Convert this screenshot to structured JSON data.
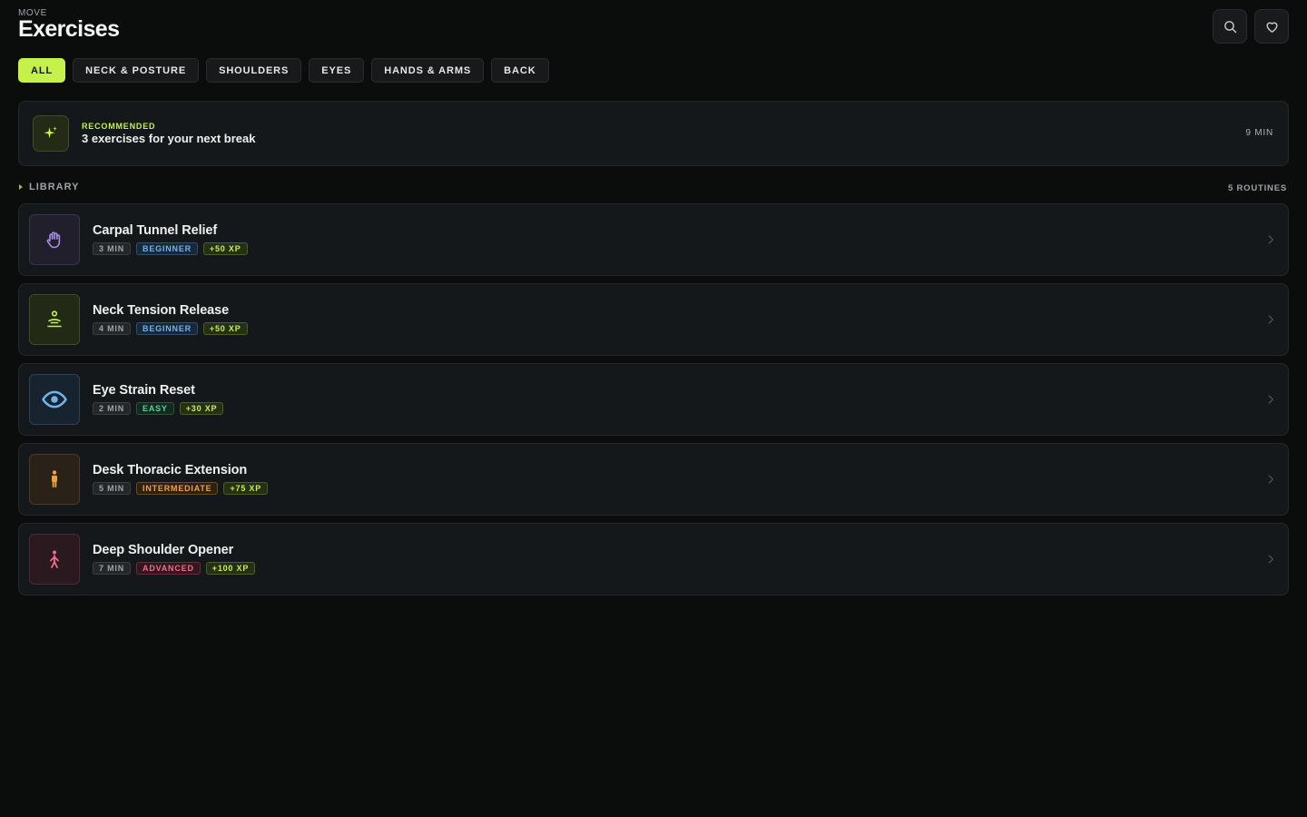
{
  "header": {
    "eyebrow": "MOVE",
    "title": "Exercises",
    "actions": [
      {
        "icon": "search-icon"
      },
      {
        "icon": "heart-icon"
      }
    ]
  },
  "filters": [
    {
      "label": "ALL",
      "active": true
    },
    {
      "label": "NECK & POSTURE",
      "active": false
    },
    {
      "label": "SHOULDERS",
      "active": false
    },
    {
      "label": "EYES",
      "active": false
    },
    {
      "label": "HANDS & ARMS",
      "active": false
    },
    {
      "label": "BACK",
      "active": false
    }
  ],
  "recommended": {
    "icon": "sparkle-icon",
    "eyebrow": "RECOMMENDED",
    "title": "3 exercises for your next break",
    "duration": "9 MIN"
  },
  "library": {
    "label": "LIBRARY",
    "count": "5 ROUTINES"
  },
  "routines": [
    {
      "name": "Carpal Tunnel Relief",
      "icon": "hand-icon",
      "duration": "3 MIN",
      "level": "BEGINNER",
      "xp": "+50 XP",
      "icon_color": "#a98ee8",
      "icon_bg": "#221f2c",
      "icon_border": "#3b3550",
      "level_color": "#6fb4ee",
      "level_bg": "#17283a",
      "level_border": "#2a4f72"
    },
    {
      "name": "Neck Tension Release",
      "icon": "meditation-icon",
      "duration": "4 MIN",
      "level": "BEGINNER",
      "xp": "+50 XP",
      "icon_color": "#c6f14a",
      "icon_bg": "#222a16",
      "icon_border": "#3f4d24",
      "level_color": "#6fb4ee",
      "level_bg": "#17283a",
      "level_border": "#2a4f72"
    },
    {
      "name": "Eye Strain Reset",
      "icon": "eye-icon",
      "duration": "2 MIN",
      "level": "EASY",
      "xp": "+30 XP",
      "icon_color": "#6fb4ee",
      "icon_bg": "#17242f",
      "icon_border": "#2a4152",
      "level_color": "#56d39b",
      "level_bg": "#14291f",
      "level_border": "#26533d"
    },
    {
      "name": "Desk Thoracic Extension",
      "icon": "person-standing-icon",
      "duration": "5 MIN",
      "level": "INTERMEDIATE",
      "xp": "+75 XP",
      "icon_color": "#f0a23c",
      "icon_bg": "#2a2118",
      "icon_border": "#4a3a26",
      "level_color": "#f0a23c",
      "level_bg": "#2f2112",
      "level_border": "#6a4a1f"
    },
    {
      "name": "Deep Shoulder Opener",
      "icon": "person-stretch-icon",
      "duration": "7 MIN",
      "level": "ADVANCED",
      "xp": "+100 XP",
      "icon_color": "#f06c8c",
      "icon_bg": "#2a1a1f",
      "icon_border": "#4d2a35",
      "level_color": "#f06c8c",
      "level_bg": "#33161e",
      "level_border": "#6b2a3b"
    }
  ]
}
